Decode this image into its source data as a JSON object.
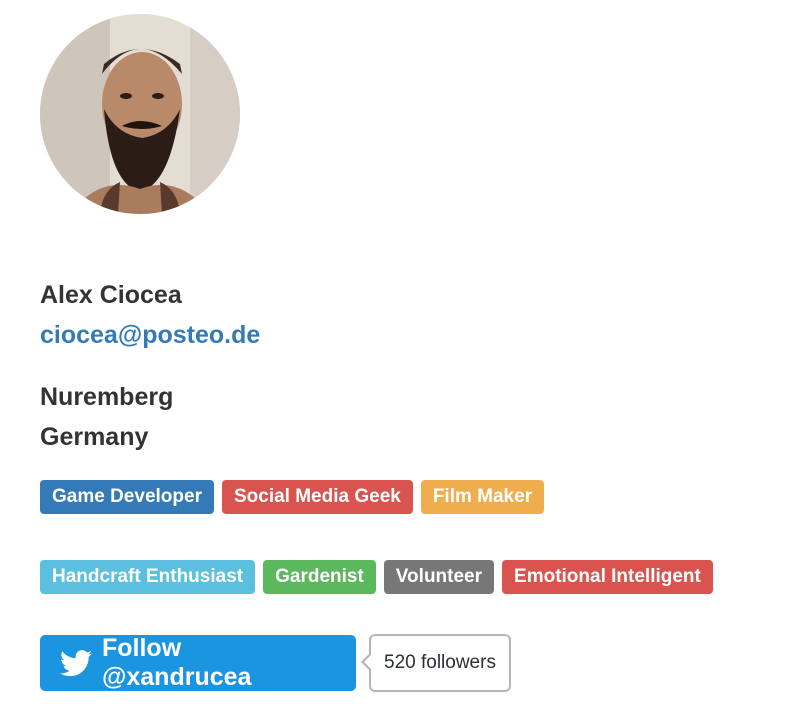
{
  "profile": {
    "avatar_alt": "avatar",
    "name": "Alex Ciocea",
    "email": "ciocea@posteo.de",
    "city": "Nuremberg",
    "country": "Germany"
  },
  "tags_row1": [
    {
      "label": "Game Developer",
      "color": "#337ab7"
    },
    {
      "label": "Social Media Geek",
      "color": "#d9534f"
    },
    {
      "label": "Film Maker",
      "color": "#f0ad4e"
    }
  ],
  "tags_row2": [
    {
      "label": "Handcraft Enthusiast",
      "color": "#5bc0de"
    },
    {
      "label": "Gardenist",
      "color": "#5cb85c"
    },
    {
      "label": "Volunteer",
      "color": "#777777"
    },
    {
      "label": "Emotional Intelligent",
      "color": "#d9534f"
    }
  ],
  "twitter": {
    "follow_label": "Follow @xandrucea",
    "followers_label": "520 followers",
    "icon": "twitter-bird-icon",
    "color": "#1b95e0"
  }
}
